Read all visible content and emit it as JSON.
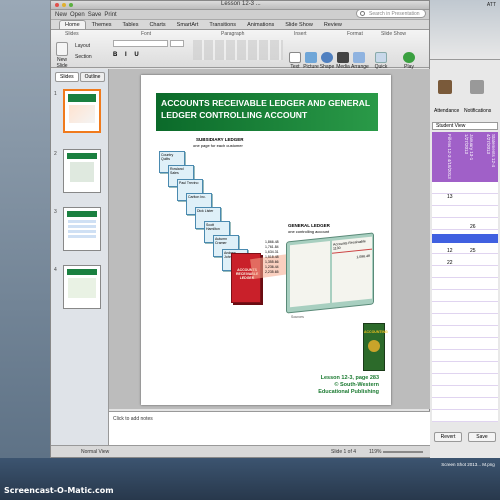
{
  "window": {
    "title": "Lesson 12-3 ..."
  },
  "qat": {
    "new": "New",
    "open": "Open",
    "save": "Save",
    "print": "Print"
  },
  "search": {
    "placeholder": "Search in Presentation"
  },
  "tabs": [
    "Home",
    "Themes",
    "Tables",
    "Charts",
    "SmartArt",
    "Transitions",
    "Animations",
    "Slide Show",
    "Review"
  ],
  "ribbon": {
    "groups": [
      "Slides",
      "Font",
      "Paragraph",
      "Insert",
      "Format",
      "Slide Show"
    ],
    "new_slide": "New Slide",
    "layout": "Layout",
    "section": "Section",
    "buttons": [
      "Text",
      "Picture",
      "Shape",
      "Media",
      "Arrange",
      "Quick Styles",
      "Play"
    ]
  },
  "left_panel": {
    "tabs": [
      "Slides",
      "Outline"
    ],
    "slide_numbers": [
      "1",
      "2",
      "3",
      "4"
    ]
  },
  "slide": {
    "title": "ACCOUNTS RECEIVABLE LEDGER AND GENERAL LEDGER CONTROLLING ACCOUNT",
    "subsidiary_title": "SUBSIDIARY LEDGER",
    "subsidiary_sub": "one page for each customer",
    "customers": [
      "Country Quilts",
      "Rowland Sales",
      "Paul Trevino",
      "Carlton Inc.",
      "Dick Lister",
      "Scott Hamilton",
      "Autumn Cramer",
      "Andrew Johnson"
    ],
    "amounts": [
      "1,866.48",
      "1,761.84",
      "1,634.31",
      "1,518.48",
      "1,355.66",
      "1,236.44",
      "2,235.65"
    ],
    "general_title": "GENERAL LEDGER",
    "general_sub": "one controlling account",
    "ar_label": "Accounts Receivable  1130",
    "ar_amount": "1,086.48",
    "red_book": "ACCOUNTS RECEIVABLE LEDGER",
    "sources": "Sources",
    "footer": [
      "Lesson 12-3, page 283",
      "© South-Western",
      "Educational Publishing"
    ],
    "book_title": "ACCOUNTING"
  },
  "notes": {
    "placeholder": "Click to add notes"
  },
  "status": {
    "view": "Normal View",
    "slide_of": "Slide 1 of 4",
    "zoom": "119%"
  },
  "right_panel": {
    "top_label": "ATT",
    "attendance": "Attendance",
    "notifications": "Notifications",
    "student_view": "Student View",
    "col_headers": [
      "Fill-Ins 12-3 4/18/2013",
      "January 13-1 1/27/2013",
      "Statements 12-4 4/27/2013"
    ],
    "values": [
      "13",
      "26",
      "12",
      "25",
      "22"
    ],
    "revert": "Revert",
    "save": "Save"
  },
  "desktop": {
    "screenshot_label": "Screen Shot 2013... M.png",
    "watermark": "Screencast-O-Matic.com"
  }
}
